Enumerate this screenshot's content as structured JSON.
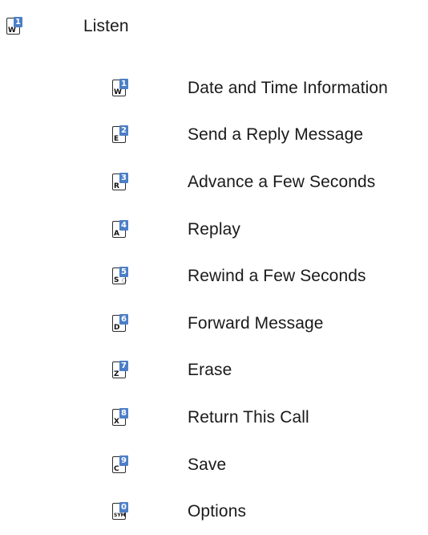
{
  "main_item": {
    "key_letter": "W",
    "key_number": "1",
    "label": "Listen"
  },
  "submenu": [
    {
      "key_letter": "W",
      "key_number": "1",
      "label": "Date and Time Information"
    },
    {
      "key_letter": "E",
      "key_number": "2",
      "label": "Send a Reply Message"
    },
    {
      "key_letter": "R",
      "key_number": "3",
      "label": "Advance a Few Seconds"
    },
    {
      "key_letter": "A",
      "key_number": "4",
      "label": "Replay"
    },
    {
      "key_letter": "S",
      "key_number": "5",
      "key_extra": "○",
      "label": "Rewind a Few Seconds"
    },
    {
      "key_letter": "D",
      "key_number": "6",
      "label": "Forward Message"
    },
    {
      "key_letter": "Z",
      "key_number": "7",
      "label": "Erase"
    },
    {
      "key_letter": "X",
      "key_number": "8",
      "label": "Return This Call"
    },
    {
      "key_letter": "C",
      "key_number": "9",
      "label": "Save"
    },
    {
      "key_letter": "SYM",
      "key_number": "0",
      "label": "Options"
    }
  ],
  "colors": {
    "key_number_bg": "#4c7fc7",
    "text": "#1a1a1a"
  }
}
